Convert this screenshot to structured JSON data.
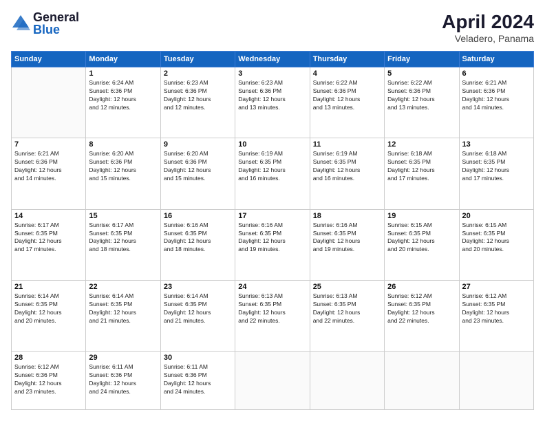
{
  "logo": {
    "general": "General",
    "blue": "Blue"
  },
  "title": "April 2024",
  "location": "Veladero, Panama",
  "days_header": [
    "Sunday",
    "Monday",
    "Tuesday",
    "Wednesday",
    "Thursday",
    "Friday",
    "Saturday"
  ],
  "weeks": [
    [
      {
        "num": "",
        "info": ""
      },
      {
        "num": "1",
        "info": "Sunrise: 6:24 AM\nSunset: 6:36 PM\nDaylight: 12 hours\nand 12 minutes."
      },
      {
        "num": "2",
        "info": "Sunrise: 6:23 AM\nSunset: 6:36 PM\nDaylight: 12 hours\nand 12 minutes."
      },
      {
        "num": "3",
        "info": "Sunrise: 6:23 AM\nSunset: 6:36 PM\nDaylight: 12 hours\nand 13 minutes."
      },
      {
        "num": "4",
        "info": "Sunrise: 6:22 AM\nSunset: 6:36 PM\nDaylight: 12 hours\nand 13 minutes."
      },
      {
        "num": "5",
        "info": "Sunrise: 6:22 AM\nSunset: 6:36 PM\nDaylight: 12 hours\nand 13 minutes."
      },
      {
        "num": "6",
        "info": "Sunrise: 6:21 AM\nSunset: 6:36 PM\nDaylight: 12 hours\nand 14 minutes."
      }
    ],
    [
      {
        "num": "7",
        "info": "Sunrise: 6:21 AM\nSunset: 6:36 PM\nDaylight: 12 hours\nand 14 minutes."
      },
      {
        "num": "8",
        "info": "Sunrise: 6:20 AM\nSunset: 6:36 PM\nDaylight: 12 hours\nand 15 minutes."
      },
      {
        "num": "9",
        "info": "Sunrise: 6:20 AM\nSunset: 6:36 PM\nDaylight: 12 hours\nand 15 minutes."
      },
      {
        "num": "10",
        "info": "Sunrise: 6:19 AM\nSunset: 6:35 PM\nDaylight: 12 hours\nand 16 minutes."
      },
      {
        "num": "11",
        "info": "Sunrise: 6:19 AM\nSunset: 6:35 PM\nDaylight: 12 hours\nand 16 minutes."
      },
      {
        "num": "12",
        "info": "Sunrise: 6:18 AM\nSunset: 6:35 PM\nDaylight: 12 hours\nand 17 minutes."
      },
      {
        "num": "13",
        "info": "Sunrise: 6:18 AM\nSunset: 6:35 PM\nDaylight: 12 hours\nand 17 minutes."
      }
    ],
    [
      {
        "num": "14",
        "info": "Sunrise: 6:17 AM\nSunset: 6:35 PM\nDaylight: 12 hours\nand 17 minutes."
      },
      {
        "num": "15",
        "info": "Sunrise: 6:17 AM\nSunset: 6:35 PM\nDaylight: 12 hours\nand 18 minutes."
      },
      {
        "num": "16",
        "info": "Sunrise: 6:16 AM\nSunset: 6:35 PM\nDaylight: 12 hours\nand 18 minutes."
      },
      {
        "num": "17",
        "info": "Sunrise: 6:16 AM\nSunset: 6:35 PM\nDaylight: 12 hours\nand 19 minutes."
      },
      {
        "num": "18",
        "info": "Sunrise: 6:16 AM\nSunset: 6:35 PM\nDaylight: 12 hours\nand 19 minutes."
      },
      {
        "num": "19",
        "info": "Sunrise: 6:15 AM\nSunset: 6:35 PM\nDaylight: 12 hours\nand 20 minutes."
      },
      {
        "num": "20",
        "info": "Sunrise: 6:15 AM\nSunset: 6:35 PM\nDaylight: 12 hours\nand 20 minutes."
      }
    ],
    [
      {
        "num": "21",
        "info": "Sunrise: 6:14 AM\nSunset: 6:35 PM\nDaylight: 12 hours\nand 20 minutes."
      },
      {
        "num": "22",
        "info": "Sunrise: 6:14 AM\nSunset: 6:35 PM\nDaylight: 12 hours\nand 21 minutes."
      },
      {
        "num": "23",
        "info": "Sunrise: 6:14 AM\nSunset: 6:35 PM\nDaylight: 12 hours\nand 21 minutes."
      },
      {
        "num": "24",
        "info": "Sunrise: 6:13 AM\nSunset: 6:35 PM\nDaylight: 12 hours\nand 22 minutes."
      },
      {
        "num": "25",
        "info": "Sunrise: 6:13 AM\nSunset: 6:35 PM\nDaylight: 12 hours\nand 22 minutes."
      },
      {
        "num": "26",
        "info": "Sunrise: 6:12 AM\nSunset: 6:35 PM\nDaylight: 12 hours\nand 22 minutes."
      },
      {
        "num": "27",
        "info": "Sunrise: 6:12 AM\nSunset: 6:35 PM\nDaylight: 12 hours\nand 23 minutes."
      }
    ],
    [
      {
        "num": "28",
        "info": "Sunrise: 6:12 AM\nSunset: 6:36 PM\nDaylight: 12 hours\nand 23 minutes."
      },
      {
        "num": "29",
        "info": "Sunrise: 6:11 AM\nSunset: 6:36 PM\nDaylight: 12 hours\nand 24 minutes."
      },
      {
        "num": "30",
        "info": "Sunrise: 6:11 AM\nSunset: 6:36 PM\nDaylight: 12 hours\nand 24 minutes."
      },
      {
        "num": "",
        "info": ""
      },
      {
        "num": "",
        "info": ""
      },
      {
        "num": "",
        "info": ""
      },
      {
        "num": "",
        "info": ""
      }
    ]
  ]
}
